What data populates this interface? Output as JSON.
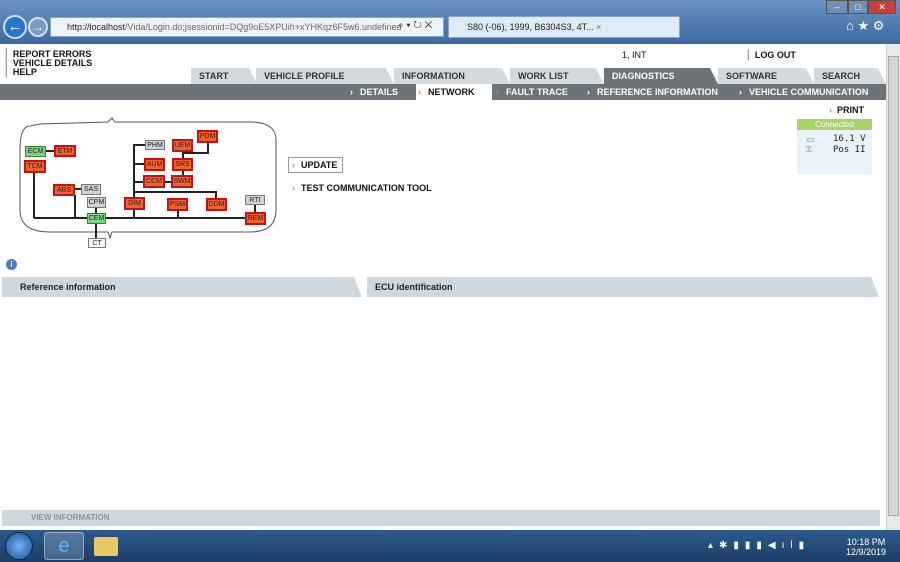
{
  "browser": {
    "url_host": "http://localhost",
    "url_path": "/Vida/Login.do;jsessionid=DQg9oE5XPUih+xYHKqz6F5w6.undefined",
    "tab_title": "S80 (-06), 1999, B6304S3, 4T...",
    "back_icon": "back-arrow-icon",
    "forward_icon": "forward-arrow-icon"
  },
  "top_links": [
    "REPORT ERRORS",
    "VEHICLE DETAILS",
    "HELP"
  ],
  "user": "1, INT",
  "logout": "LOG OUT",
  "tabs": [
    {
      "label": "START"
    },
    {
      "label": "VEHICLE PROFILE"
    },
    {
      "label": "INFORMATION"
    },
    {
      "label": "WORK LIST"
    },
    {
      "label": "DIAGNOSTICS",
      "active": true
    },
    {
      "label": "SOFTWARE"
    },
    {
      "label": "SEARCH"
    }
  ],
  "subtabs": [
    {
      "label": "DETAILS"
    },
    {
      "label": "NETWORK",
      "active": true
    },
    {
      "label": "FAULT TRACE"
    },
    {
      "label": "REFERENCE INFORMATION"
    },
    {
      "label": "VEHICLE COMMUNICATION"
    }
  ],
  "network": {
    "nodes": [
      {
        "id": "ECM",
        "status": "ok"
      },
      {
        "id": "ETM",
        "status": "fault"
      },
      {
        "id": "TCM",
        "status": "fault"
      },
      {
        "id": "ABS",
        "status": "fault"
      },
      {
        "id": "SAS",
        "status": "unknown"
      },
      {
        "id": "CPM",
        "status": "unknown"
      },
      {
        "id": "CEM",
        "status": "ok"
      },
      {
        "id": "CT",
        "status": "none"
      },
      {
        "id": "DIM",
        "status": "fault"
      },
      {
        "id": "PHM",
        "status": "unknown"
      },
      {
        "id": "UEM",
        "status": "fault"
      },
      {
        "id": "PDM",
        "status": "fault"
      },
      {
        "id": "AUM",
        "status": "fault"
      },
      {
        "id": "SRS",
        "status": "fault"
      },
      {
        "id": "CCM",
        "status": "fault"
      },
      {
        "id": "SWM",
        "status": "fault"
      },
      {
        "id": "PSM",
        "status": "fault"
      },
      {
        "id": "DDM",
        "status": "fault"
      },
      {
        "id": "RTI",
        "status": "unknown"
      },
      {
        "id": "REM",
        "status": "fault"
      }
    ]
  },
  "update": "UPDATE",
  "test_comm": "TEST COMMUNICATION TOOL",
  "print": "PRINT",
  "status": {
    "connection": "Connected",
    "voltage": "16.1 V",
    "ignition": "Pos II",
    "connected_color": "#a8d36a"
  },
  "panels": {
    "reference": "Reference information",
    "ecu": "ECU identification"
  },
  "view_info": "VIEW INFORMATION",
  "taskbar": {
    "time": "10:18 PM",
    "date": "12/9/2019"
  }
}
